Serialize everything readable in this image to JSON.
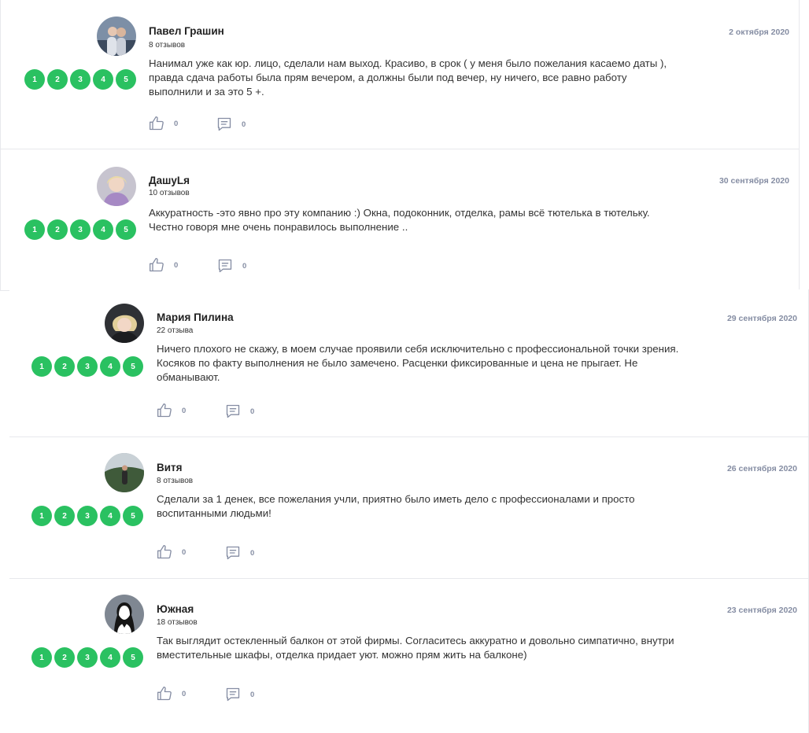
{
  "colors": {
    "rating": "#2ac161",
    "muted": "#858da3",
    "separator": "#e7e8ec"
  },
  "icons": {
    "like": "thumbs-up-icon",
    "comment": "comment-icon"
  },
  "reviews": [
    {
      "author": "Павел Грашин",
      "reviews_count": "8 отзывов",
      "date": "2 октября 2020",
      "rating": [
        "1",
        "2",
        "3",
        "4",
        "5"
      ],
      "text": [
        "Нанимал уже как юр. лицо, сделали нам выход. Красиво, в срок ( у меня было пожелания касаемо даты ),",
        "правда сдача работы была прям вечером, а должны были под вечер, ну ничего, все равно работу",
        "выполнили и за это 5 +."
      ],
      "likes": "0",
      "comments": "0"
    },
    {
      "author": "ДашуLя",
      "reviews_count": "10 отзывов",
      "date": "30 сентября 2020",
      "rating": [
        "1",
        "2",
        "3",
        "4",
        "5"
      ],
      "text": [
        "Аккуратность -это явно про эту компанию :) Окна, подоконник, отделка, рамы всё тютелька в тютельку.",
        "Честно говоря мне очень понравилось выполнение .."
      ],
      "likes": "0",
      "comments": "0"
    },
    {
      "author": "Мария Пилина",
      "reviews_count": "22 отзыва",
      "date": "29 сентября 2020",
      "rating": [
        "1",
        "2",
        "3",
        "4",
        "5"
      ],
      "text": [
        "Ничего плохого не скажу, в моем случае проявили себя исключительно с профессиональной точки зрения.",
        "Косяков по факту выполнения не было замечено. Расценки фиксированные и цена не прыгает. Не",
        "обманывают."
      ],
      "likes": "0",
      "comments": "0"
    },
    {
      "author": "Витя",
      "reviews_count": "8 отзывов",
      "date": "26 сентября 2020",
      "rating": [
        "1",
        "2",
        "3",
        "4",
        "5"
      ],
      "text": [
        "Сделали за 1 денек, все пожелания учли, приятно было иметь дело с профессионалами и просто",
        "воспитанными людьми!"
      ],
      "likes": "0",
      "comments": "0"
    },
    {
      "author": "Южная",
      "reviews_count": "18 отзывов",
      "date": "23 сентября 2020",
      "rating": [
        "1",
        "2",
        "3",
        "4",
        "5"
      ],
      "text": [
        "Так выглядит остекленный балкон от этой фирмы. Согласитесь аккуратно и довольно симпатично, внутри",
        "вместительные шкафы, отделка придает уют. можно прям жить на балконе)"
      ],
      "likes": "0",
      "comments": "0"
    }
  ]
}
